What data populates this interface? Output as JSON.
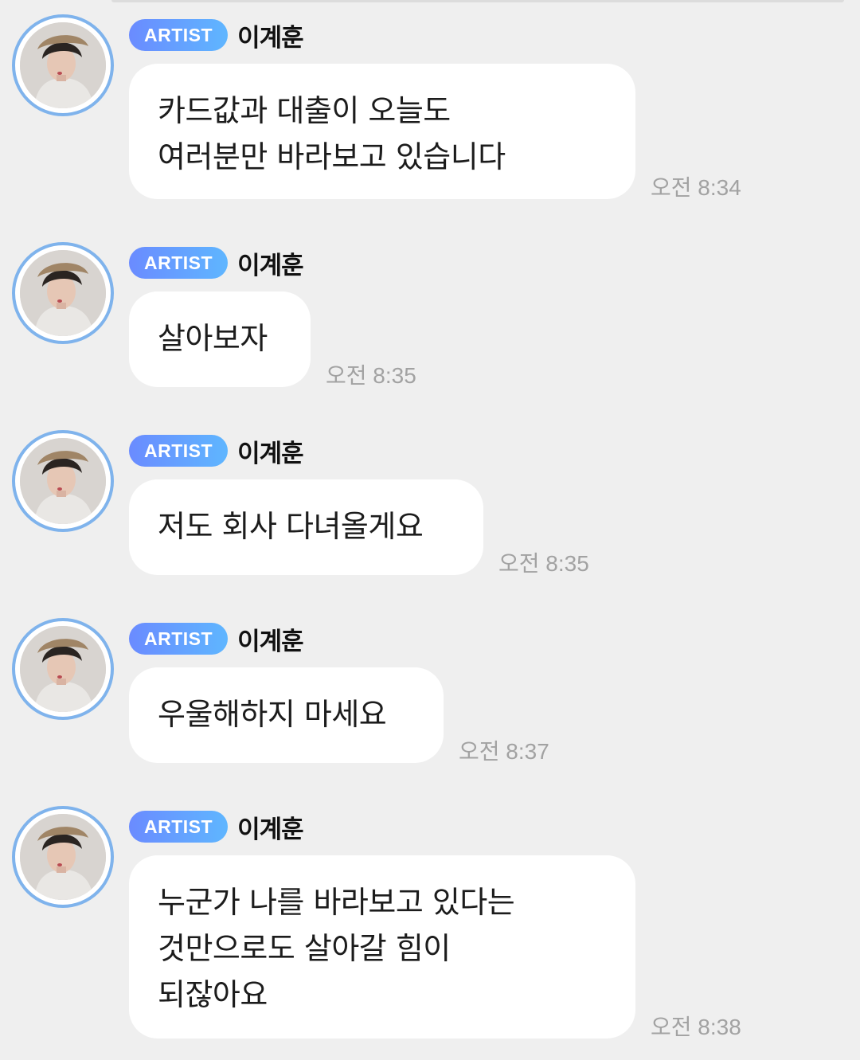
{
  "messages": [
    {
      "badge": "ARTIST",
      "sender": "이계훈",
      "text": "카드값과 대출이 오늘도\n여러분만 바라보고 있습니다",
      "time": "오전 8:34"
    },
    {
      "badge": "ARTIST",
      "sender": "이계훈",
      "text": "살아보자",
      "time": "오전 8:35"
    },
    {
      "badge": "ARTIST",
      "sender": "이계훈",
      "text": "저도 회사 다녀올게요",
      "time": "오전 8:35"
    },
    {
      "badge": "ARTIST",
      "sender": "이계훈",
      "text": "우울해하지 마세요",
      "time": "오전 8:37"
    },
    {
      "badge": "ARTIST",
      "sender": "이계훈",
      "text": "누군가 나를 바라보고 있다는\n것만으로도 살아갈 힘이\n되잖아요",
      "time": "오전 8:38"
    }
  ],
  "colors": {
    "background": "#efefef",
    "bubble": "#ffffff",
    "badge_gradient_start": "#6a8bff",
    "badge_gradient_end": "#5fb6ff",
    "avatar_ring": "#7fb3ec",
    "timestamp": "#a2a2a2"
  }
}
